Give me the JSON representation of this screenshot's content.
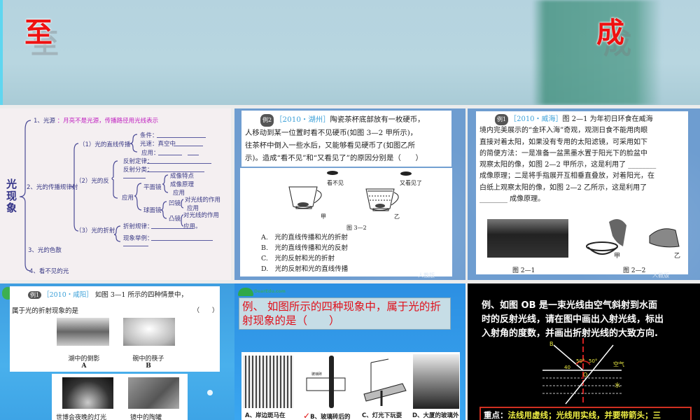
{
  "banner": {
    "left_char": "至",
    "right_char": "成"
  },
  "mindmap": {
    "title": "光现象",
    "item1": "1、光源",
    "item1_note": "：月亮不是光源，传播路径用光线表示",
    "item2": "2、光的传播规律射",
    "sub1": "（1）光的直线传播",
    "cond": "条件：",
    "speed": "光速：真空中",
    "use1": "应用：",
    "sub2": "（2）光的反",
    "refl_law": "反射定律：",
    "refl_type": "反射分类：",
    "use2": "应用",
    "plane": "平面镜",
    "img_feat": "成像特点",
    "img_prin": "成像原理",
    "use3": "应用",
    "sphere": "球面镜",
    "concave": "凹镜",
    "effect1": "对光线的作用",
    "use4": "应用",
    "convex": "凸镜",
    "effect2": "对光线的作用",
    "use5": "应用。",
    "sub3": "（3）光的折射",
    "refr_law": "折射规律：",
    "examples": "现象举例：",
    "item3": "3、光的色散",
    "item4": "4、看不见的光"
  },
  "example_huzhou": {
    "tag": "例2",
    "source": "［2010・湖州］",
    "lines": [
      "陶瓷茶杯底部放有一枚硬币，",
      "人移动到某一位置时看不见硬币(如图 3—2 甲所示)，",
      "往茶杯中倒入一些水后，又能够看见硬币了(如图乙所",
      "示)。造成“看不见”和“又看见了”的原因分别是（　　）"
    ],
    "label_left": "看不见",
    "label_right": "又看见了",
    "jia": "甲",
    "yi": "乙",
    "caption": "图 3—2",
    "options": [
      "A.　光的直线传播和光的折射",
      "B.　光的直线传播和光的反射",
      "C.　光的反射和光的折射",
      "D.　光的反射和光的直线传播"
    ],
    "watermark": "人教版"
  },
  "example_weihai": {
    "tag": "例1",
    "source": "［2010・威海］",
    "lines": [
      "图 2—1 为年初日环食在威海",
      "境内完美展示的“金环入海”奇观，观测日食不能用肉眼",
      "直接对着太阳，如果没有专用的太阳滤镜，可采用如下",
      "的简便方法：一是准备一盆黑墨水置于阳光下的脸盆中",
      "观察太阳的像，如图 2—2 甲所示，这是利用了 ________",
      "成像原理；二是将手指展开互相垂直叠放，对着阳光，在",
      "白纸上观察太阳的像，如图 2—2 乙所示，这是利用了",
      "________ 成像原理。"
    ],
    "fig1": "图 2—1",
    "fig2": "图 2—2",
    "jia": "甲",
    "yi": "乙",
    "watermark": "人教版"
  },
  "example_xianyang": {
    "tag": "例1",
    "source": "［2010・咸阳］",
    "line1": "如图 3—1 所示的四种情景中，",
    "line2": "属于光的折射现象的是",
    "paren": "（　　）",
    "a_cap": "湖中的倒影",
    "a": "A",
    "b_cap": "碗中的筷子",
    "b": "B",
    "c_cap": "世博会夜晚的灯光",
    "d_cap": "镜中的陶罐"
  },
  "example_refraction": {
    "logo": "DearEdu.com",
    "question": "例、 如图所示的四种现象中，属于光的折射现象的是（　　）",
    "captions": [
      "A、岸边斑马在",
      "B、玻璃砖后的",
      "C、灯光下玩耍",
      "D、大厦的玻璃外"
    ],
    "glass_label": "玻璃砖"
  },
  "example_ob": {
    "lines": [
      "例、如图 OB 是一束光线由空气斜射到水面",
      "时的反射光线，请在图中画出入射光线，标出",
      "入射角的度数，并画出折射光线的大致方向."
    ],
    "B": "B",
    "O": "O",
    "angle40": "40",
    "angle50a": "50°",
    "angle50b": "50°",
    "air": "空气",
    "water": "水",
    "key": "重点：",
    "key_text": "法线用虚线；光线用实线，并要带箭头；三"
  }
}
